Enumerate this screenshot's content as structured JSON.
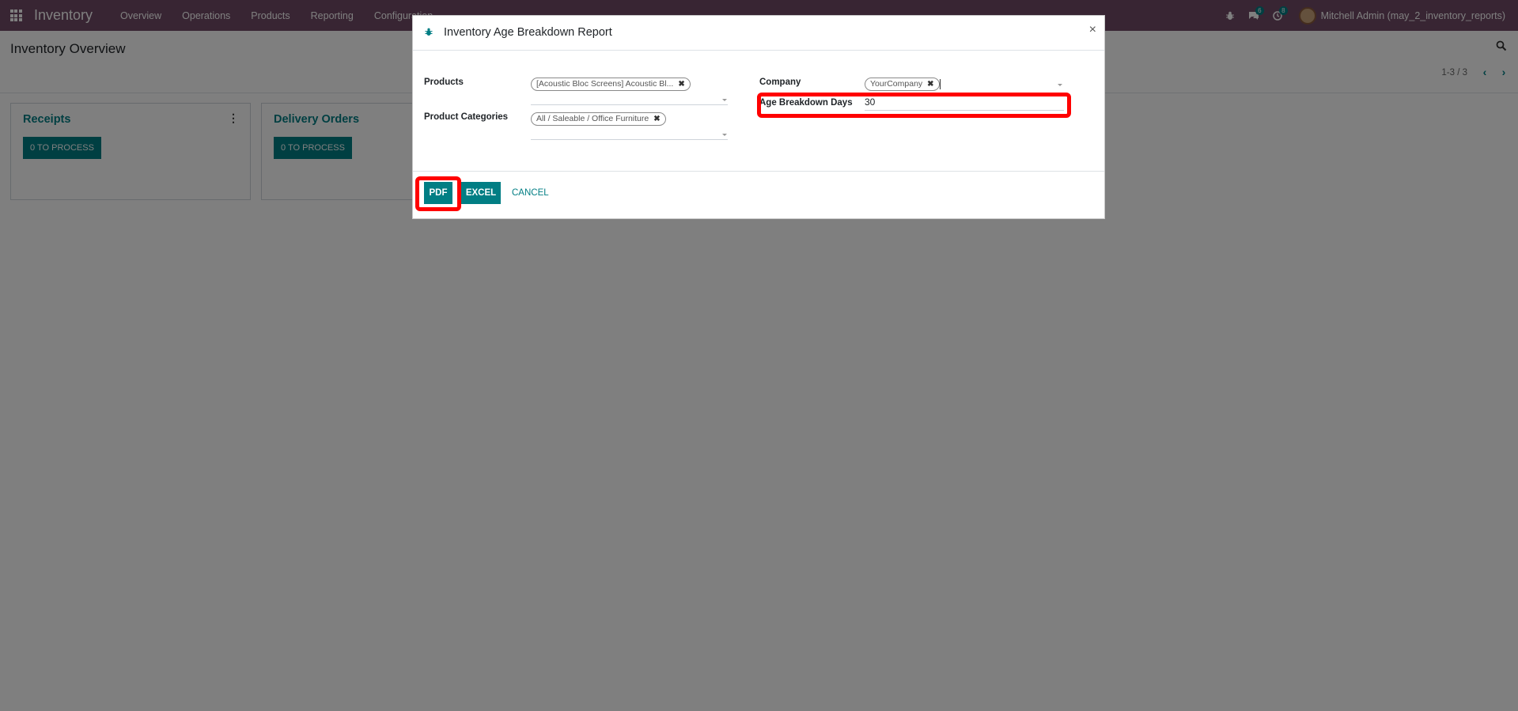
{
  "navbar": {
    "brand": "Inventory",
    "menu": [
      "Overview",
      "Operations",
      "Products",
      "Reporting",
      "Configuration"
    ],
    "chat_badge": "6",
    "activity_badge": "8",
    "user": "Mitchell Admin (may_2_inventory_reports)",
    "bg_color": "#714b67"
  },
  "control_panel": {
    "title": "Inventory Overview",
    "pager": "1-3 / 3"
  },
  "cards": [
    {
      "title": "Receipts",
      "button": "0 TO PROCESS"
    },
    {
      "title": "Delivery Orders",
      "button": "0 TO PROCESS"
    }
  ],
  "modal": {
    "title": "Inventory Age Breakdown Report",
    "close": "×",
    "fields": {
      "products_label": "Products",
      "products_tag": "[Acoustic Bloc Screens] Acoustic Bl...",
      "categories_label": "Product Categories",
      "categories_tag": "All / Saleable / Office Furniture",
      "company_label": "Company",
      "company_tag": "YourCompany",
      "age_days_label": "Age Breakdown Days",
      "age_days_value": "30"
    },
    "buttons": {
      "pdf": "PDF",
      "excel": "EXCEL",
      "cancel": "CANCEL"
    }
  },
  "colors": {
    "accent": "#017e84",
    "highlight": "#ff0000"
  }
}
